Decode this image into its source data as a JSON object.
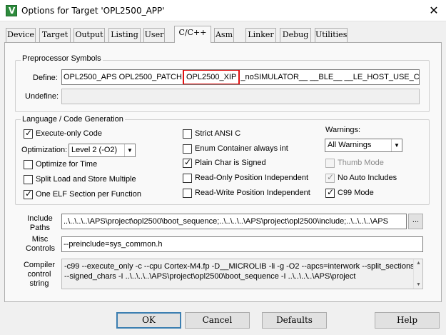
{
  "window": {
    "title": "Options for Target 'OPL2500_APP'",
    "close_icon": "close-icon"
  },
  "tabs": [
    {
      "label": "Device"
    },
    {
      "label": "Target"
    },
    {
      "label": "Output"
    },
    {
      "label": "Listing"
    },
    {
      "label": "User"
    },
    {
      "label": "C/C++",
      "active": true
    },
    {
      "label": "Asm"
    },
    {
      "label": "Linker"
    },
    {
      "label": "Debug"
    },
    {
      "label": "Utilities"
    }
  ],
  "preprocessor": {
    "group_title": "Preprocessor Symbols",
    "define_label": "Define:",
    "define_part1": "OPL2500_APS OPL2500_PATCH",
    "define_highlight": "OPL2500_XIP",
    "define_part2": "_noSIMULATOR__ __BLE__ __LE_HOST_USE_CM",
    "undefine_label": "Undefine:",
    "undefine_value": ""
  },
  "language": {
    "group_title": "Language / Code Generation",
    "execute_only": {
      "label": "Execute-only Code",
      "checked": true
    },
    "optimization_label": "Optimization:",
    "optimization_value": "Level 2 (-O2)",
    "optimize_time": {
      "label": "Optimize for Time",
      "checked": false
    },
    "split_load": {
      "label": "Split Load and Store Multiple",
      "checked": false
    },
    "one_elf": {
      "label": "One ELF Section per Function",
      "checked": true
    },
    "strict_ansi": {
      "label": "Strict ANSI C",
      "checked": false
    },
    "enum_container": {
      "label": "Enum Container always int",
      "checked": false
    },
    "plain_char": {
      "label": "Plain Char is Signed",
      "checked": true
    },
    "ro_pi": {
      "label": "Read-Only Position Independent",
      "checked": false
    },
    "rw_pi": {
      "label": "Read-Write Position Independent",
      "checked": false
    },
    "warnings_label": "Warnings:",
    "warnings_value": "All Warnings",
    "thumb_mode": {
      "label": "Thumb Mode",
      "checked": false,
      "disabled": true
    },
    "no_auto_includes": {
      "label": "No Auto Includes",
      "checked": true
    },
    "c99_mode": {
      "label": "C99 Mode",
      "checked": true
    }
  },
  "include_paths": {
    "label": "Include\nPaths",
    "value": "..\\..\\..\\..\\APS\\project\\opl2500\\boot_sequence;..\\..\\..\\..\\APS\\project\\opl2500\\include;..\\..\\..\\..\\APS",
    "browse_label": "..."
  },
  "misc_controls": {
    "label": "Misc\nControls",
    "value": "--preinclude=sys_common.h"
  },
  "compiler_string": {
    "label": "Compiler\ncontrol\nstring",
    "line1": "-c99 --execute_only -c --cpu Cortex-M4.fp -D__MICROLIB -li -g -O2 --apcs=interwork --split_sections",
    "line2": "--signed_chars -I ..\\..\\..\\..\\APS\\project\\opl2500\\boot_sequence -I ..\\..\\..\\..\\APS\\project"
  },
  "buttons": {
    "ok": "OK",
    "cancel": "Cancel",
    "defaults": "Defaults",
    "help": "Help"
  }
}
